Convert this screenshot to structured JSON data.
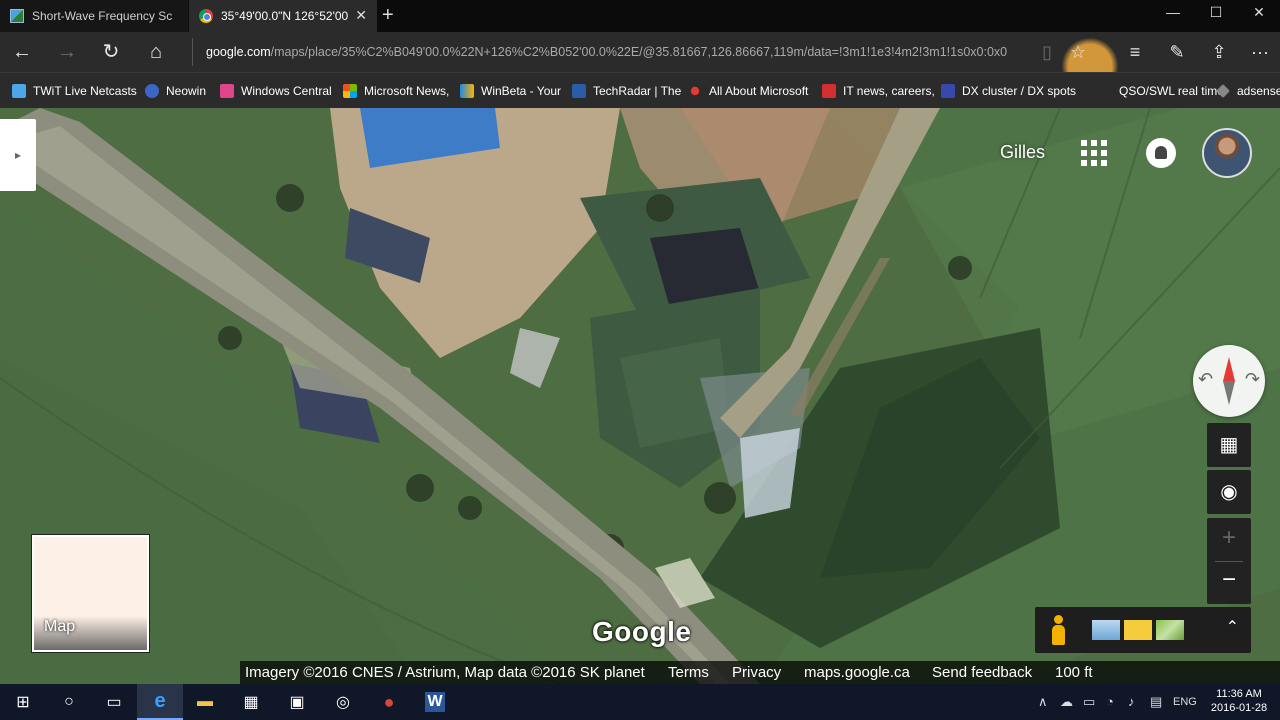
{
  "tabs": [
    {
      "title": "Short-Wave Frequency Sche",
      "favicon": "maps-site-icon"
    },
    {
      "title": "35°49'00.0\"N 126°52'00",
      "favicon": "chrome-icon",
      "close": "✕"
    }
  ],
  "new_tab_symbol": "+",
  "window_controls": [
    "—",
    "☐",
    "✕"
  ],
  "nav": {
    "back": "←",
    "forward": "→",
    "refresh": "↻",
    "home": "⌂"
  },
  "address": {
    "host": "google.com",
    "path": "/maps/place/35%C2%B049'00.0%22N+126%C2%B052'00.0%22E/@35.81667,126.86667,119m/data=!3m1!1e3!4m2!3m1!1s0x0:0x0"
  },
  "toolbar_icons": {
    "reading_view": "▯",
    "favorite": "☆",
    "hub": "≡",
    "web_note": "✎",
    "share": "⇪",
    "more": "···"
  },
  "favorites": [
    {
      "label": "TWiT Live Netcasts",
      "color": "#4ca7e8"
    },
    {
      "label": "Neowin",
      "color": "#3b66c4"
    },
    {
      "label": "Windows Central",
      "color": "#e0458c"
    },
    {
      "label": "Microsoft News,",
      "color": "#f25022"
    },
    {
      "label": "WinBeta - Your",
      "color": "#1e88e5"
    },
    {
      "label": "TechRadar | The",
      "color": "#2a5da8"
    },
    {
      "label": "All About Microsoft",
      "color": "#e53935"
    },
    {
      "label": "IT news, careers,",
      "color": "#d32f2f"
    },
    {
      "label": "DX cluster / DX spots",
      "color": "#3949ab"
    },
    {
      "label": "QSO/SWL real time",
      "color": "#2b2b2b"
    },
    {
      "label": "adsense",
      "color": "#888888"
    }
  ],
  "maps": {
    "side_panel_toggle": "▸",
    "user_name": "Gilles",
    "compass_rotate_left": "↶",
    "compass_rotate_right": "↷",
    "tilt_symbol": "▦",
    "location_symbol": "◉",
    "zoom_in": "+",
    "zoom_out": "−",
    "minimap_label": "Map",
    "logo": "Google",
    "expand_symbol": "⌃",
    "footer": {
      "attribution": "Imagery ©2016 CNES / Astrium, Map data ©2016 SK planet",
      "terms": "Terms",
      "privacy": "Privacy",
      "domain": "maps.google.ca",
      "feedback": "Send feedback",
      "scale": "100 ft"
    }
  },
  "taskbar": {
    "start": "⊞",
    "search": "○",
    "task_view": "▭",
    "edge": "e",
    "explorer": "▬",
    "store": "▦",
    "app": "▣",
    "groove": "◎",
    "word": "W",
    "language": "ENG",
    "time": "11:36 AM",
    "date": "2016-01-28",
    "tray_chevron": "∧",
    "tray_icons": [
      "☁",
      "▭",
      "◔",
      "♪",
      "▤"
    ]
  }
}
